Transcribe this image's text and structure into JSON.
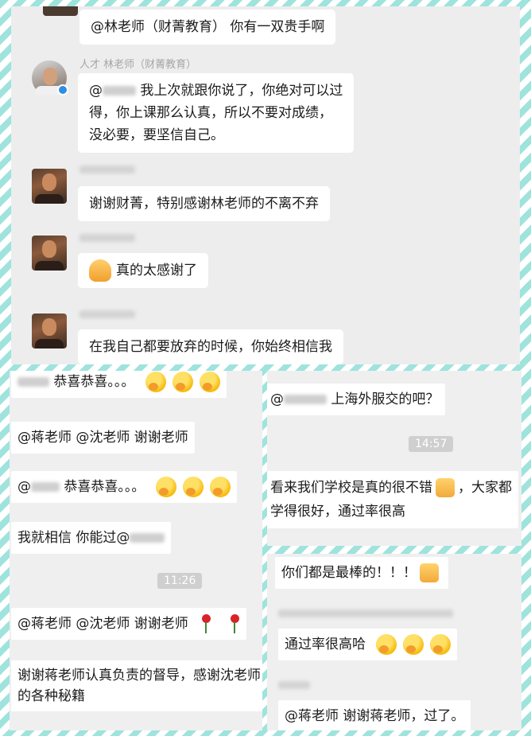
{
  "top_panel": {
    "msg1": "@林老师（财菁教育） 你有一双贵手啊",
    "teacher_name": "人才 林老师（财菁教育）",
    "msg2_prefix": "@",
    "msg2_l1": "我上次就跟你说了，你绝对可以过",
    "msg2_l2": "得，你上课那么认真，所以不要对成绩，",
    "msg2_l3": "没必要，要坚信自己。",
    "msg3": "谢谢财菁，特别感谢林老师的不离不弃",
    "msg4": "真的太感谢了",
    "msg5": "在我自己都要放弃的时候，你始终相信我"
  },
  "bottom_left": {
    "msg1_text": "恭喜恭喜。。。",
    "msg2": "@蒋老师 @沈老师 谢谢老师",
    "msg3_prefix": "@",
    "msg3_text": "恭喜恭喜。。。",
    "msg4_text": "我就相信 你能过@",
    "time": "11:26",
    "msg5": "@蒋老师 @沈老师 谢谢老师",
    "msg6_l1": "谢谢蒋老师认真负责的督导，感谢沈老师",
    "msg6_l2": "的各种秘籍"
  },
  "top_right": {
    "msg1_prefix": "@",
    "msg1_text": "上海外服交的吧？",
    "time": "14:57",
    "msg2_l1a": "看来我们学校是真的很不错",
    "msg2_l1b": "，大家都",
    "msg2_l2": "学得很好，通过率很高"
  },
  "bottom_right": {
    "msg1": "你们都是最棒的！！！",
    "msg2": "通过率很高哈",
    "msg3": "@蒋老师 谢谢蒋老师，过了。"
  },
  "icons": {
    "emoji": "hand-over-mouth-emoji",
    "thumb": "thumbs-up-emoji",
    "pray": "folded-hands-emoji",
    "rose": "rose-emoji"
  },
  "colors": {
    "border_stripe": "#9fe3dd",
    "chat_bg": "#ededed",
    "bubble": "#ffffff",
    "verified": "#2f8ee0"
  }
}
